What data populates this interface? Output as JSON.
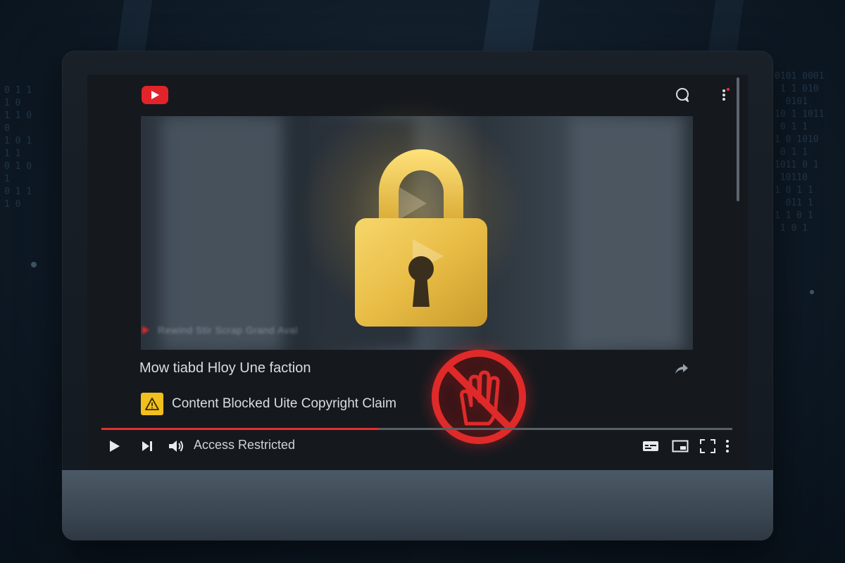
{
  "app": {
    "logo": "youtube-logo-icon"
  },
  "header": {
    "icons": [
      "chat-icon",
      "more-vert-icon"
    ]
  },
  "video": {
    "caption": "Rewind Stir Scrap Grand Aval",
    "overlay_icons": [
      "padlock-icon",
      "prohibited-hand-icon"
    ]
  },
  "title": {
    "text": "Mow tiabd Hloy Une faction"
  },
  "notice": {
    "icon": "warning-icon",
    "text": "Content Blocked Uite Copyright Claim"
  },
  "player": {
    "status_text": "Access Restricted",
    "progress": 0.44,
    "controls": [
      "play-icon",
      "next-icon",
      "volume-icon",
      "captions-icon",
      "miniplayer-icon",
      "fullscreen-icon",
      "more-vert-icon"
    ]
  },
  "colors": {
    "accent_red": "#e33030",
    "lock_gold": "#f0c24a",
    "warning_yellow": "#f2c01d"
  }
}
